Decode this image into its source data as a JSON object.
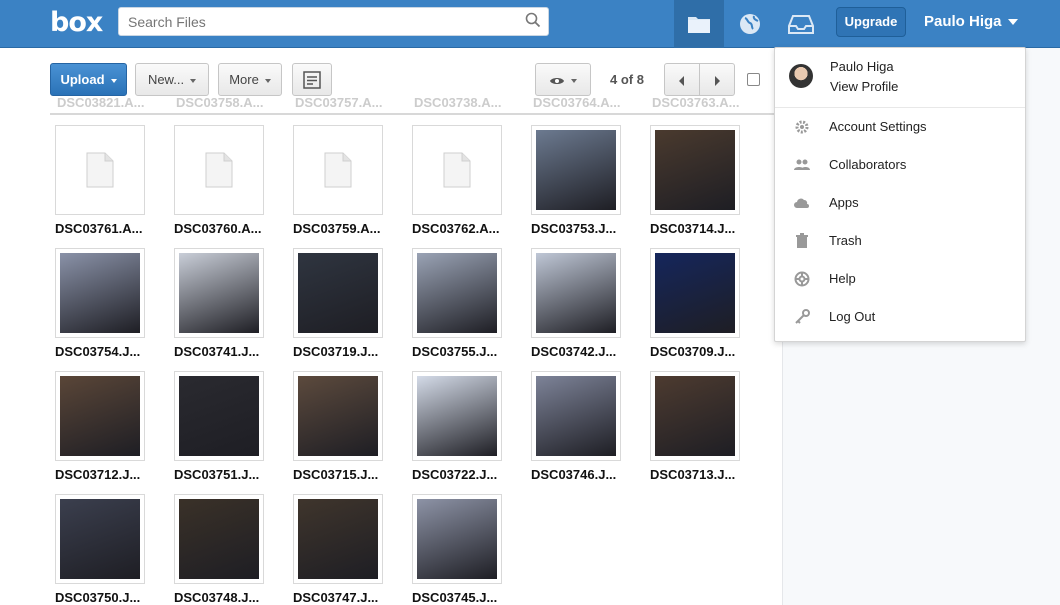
{
  "header": {
    "logo": "box",
    "search_placeholder": "Search Files",
    "upgrade_label": "Upgrade",
    "user_name": "Paulo Higa"
  },
  "toolbar": {
    "upload_label": "Upload",
    "new_label": "New...",
    "more_label": "More",
    "page_info": "4 of 8"
  },
  "ghost_row": [
    "DSC03821.A...",
    "DSC03758.A...",
    "DSC03757.A...",
    "DSC03738.A...",
    "DSC03764.A...",
    "DSC03763.A..."
  ],
  "files": [
    {
      "name": "DSC03761.A...",
      "kind": "doc"
    },
    {
      "name": "DSC03760.A...",
      "kind": "doc"
    },
    {
      "name": "DSC03759.A...",
      "kind": "doc"
    },
    {
      "name": "DSC03762.A...",
      "kind": "doc"
    },
    {
      "name": "DSC03753.J...",
      "kind": "photo",
      "color": "#6c7a90"
    },
    {
      "name": "DSC03714.J...",
      "kind": "photo",
      "color": "#4a3a2e"
    },
    {
      "name": "DSC03754.J...",
      "kind": "photo",
      "color": "#8a92a8"
    },
    {
      "name": "DSC03741.J...",
      "kind": "photo",
      "color": "#c9ced8"
    },
    {
      "name": "DSC03719.J...",
      "kind": "photo",
      "color": "#2f3540"
    },
    {
      "name": "DSC03755.J...",
      "kind": "photo",
      "color": "#9aa3b5"
    },
    {
      "name": "DSC03742.J...",
      "kind": "photo",
      "color": "#bfc7d6"
    },
    {
      "name": "DSC03709.J...",
      "kind": "photo",
      "color": "#15265c"
    },
    {
      "name": "DSC03712.J...",
      "kind": "photo",
      "color": "#5a4638"
    },
    {
      "name": "DSC03751.J...",
      "kind": "photo",
      "color": "#2a2a30"
    },
    {
      "name": "DSC03715.J...",
      "kind": "photo",
      "color": "#5c4a3d"
    },
    {
      "name": "DSC03722.J...",
      "kind": "photo",
      "color": "#d4dbe8"
    },
    {
      "name": "DSC03746.J...",
      "kind": "photo",
      "color": "#7d8398"
    },
    {
      "name": "DSC03713.J...",
      "kind": "photo",
      "color": "#4d3b30"
    },
    {
      "name": "DSC03750.J...",
      "kind": "photo",
      "color": "#3b3f4e"
    },
    {
      "name": "DSC03748.J...",
      "kind": "photo",
      "color": "#3a3128"
    },
    {
      "name": "DSC03747.J...",
      "kind": "photo",
      "color": "#3f352c"
    },
    {
      "name": "DSC03745.J...",
      "kind": "photo",
      "color": "#8d93a6"
    }
  ],
  "user_menu": {
    "name": "Paulo Higa",
    "profile_link": "View Profile",
    "items": [
      {
        "label": "Account Settings",
        "icon": "gear-icon"
      },
      {
        "label": "Collaborators",
        "icon": "people-icon"
      },
      {
        "label": "Apps",
        "icon": "cloud-icon"
      },
      {
        "label": "Trash",
        "icon": "trash-icon"
      },
      {
        "label": "Help",
        "icon": "lifebuoy-icon"
      },
      {
        "label": "Log Out",
        "icon": "key-icon"
      }
    ]
  },
  "colors": {
    "header_bg": "#3b82c4",
    "accent": "#2a72b7"
  }
}
